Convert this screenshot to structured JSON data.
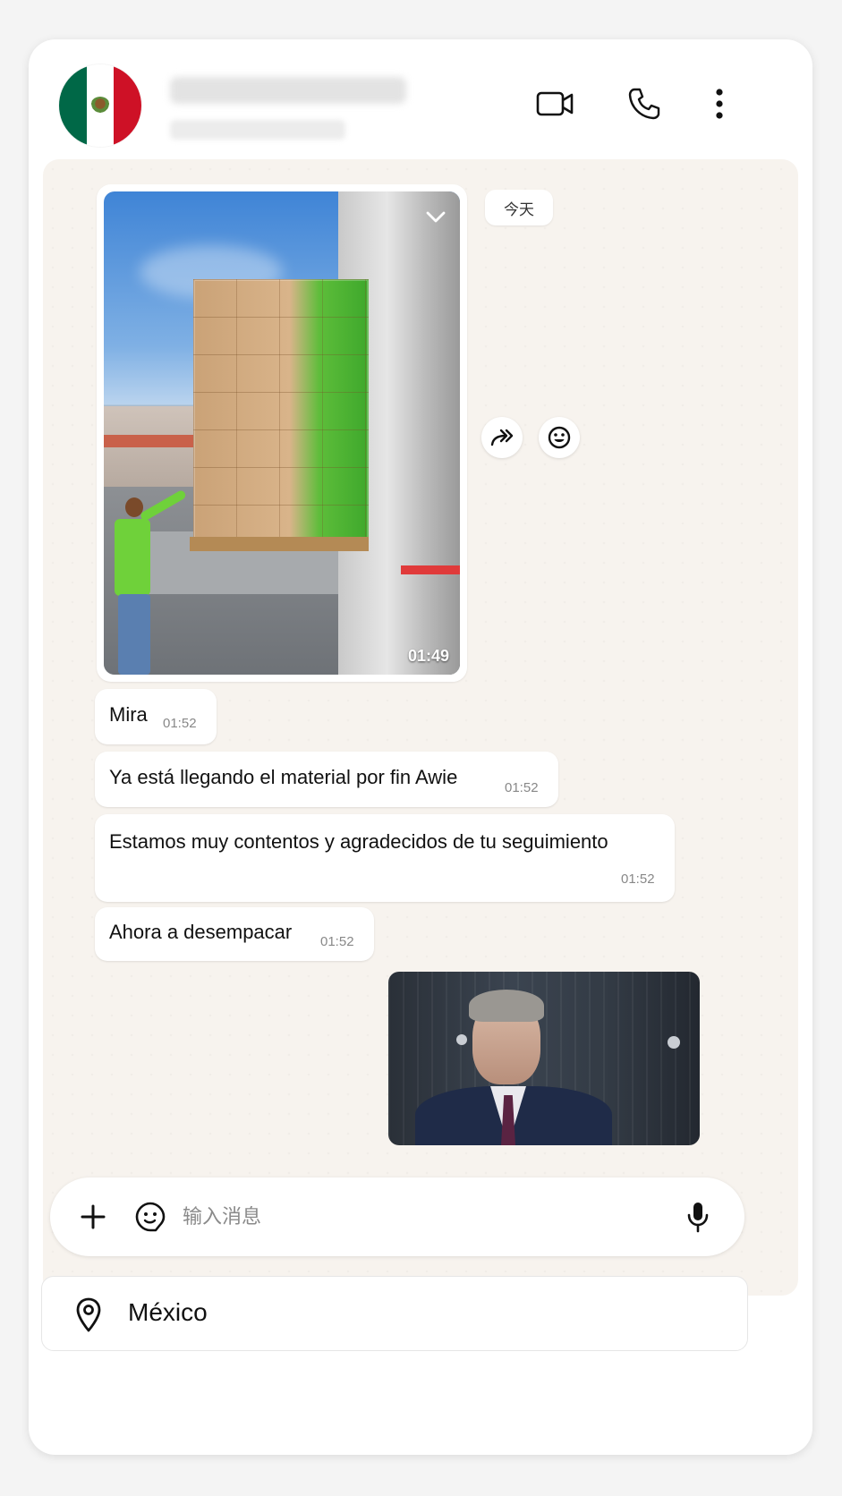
{
  "header": {
    "contact_avatar": "mexico-flag",
    "icons": {
      "video": "video-camera-icon",
      "call": "phone-icon",
      "more": "more-vertical-icon"
    }
  },
  "chat": {
    "date_label": "今天",
    "video_message": {
      "duration": "01:49"
    },
    "actions": {
      "forward": "forward-icon",
      "react": "emoji-react-icon"
    },
    "messages": [
      {
        "text": "Mira",
        "time": "01:52"
      },
      {
        "text": "Ya está llegando el material por fin Awie",
        "time": "01:52"
      },
      {
        "text": "Estamos muy contentos y agradecidos de tu seguimiento",
        "time": "01:52"
      },
      {
        "text": "Ahora a desempacar",
        "time": "01:52"
      }
    ]
  },
  "composer": {
    "placeholder": "输入消息",
    "value": ""
  },
  "location": {
    "label": "México"
  },
  "colors": {
    "chat_background": "#f7f3ee",
    "flag_green": "#006847",
    "flag_red": "#ce1126"
  }
}
